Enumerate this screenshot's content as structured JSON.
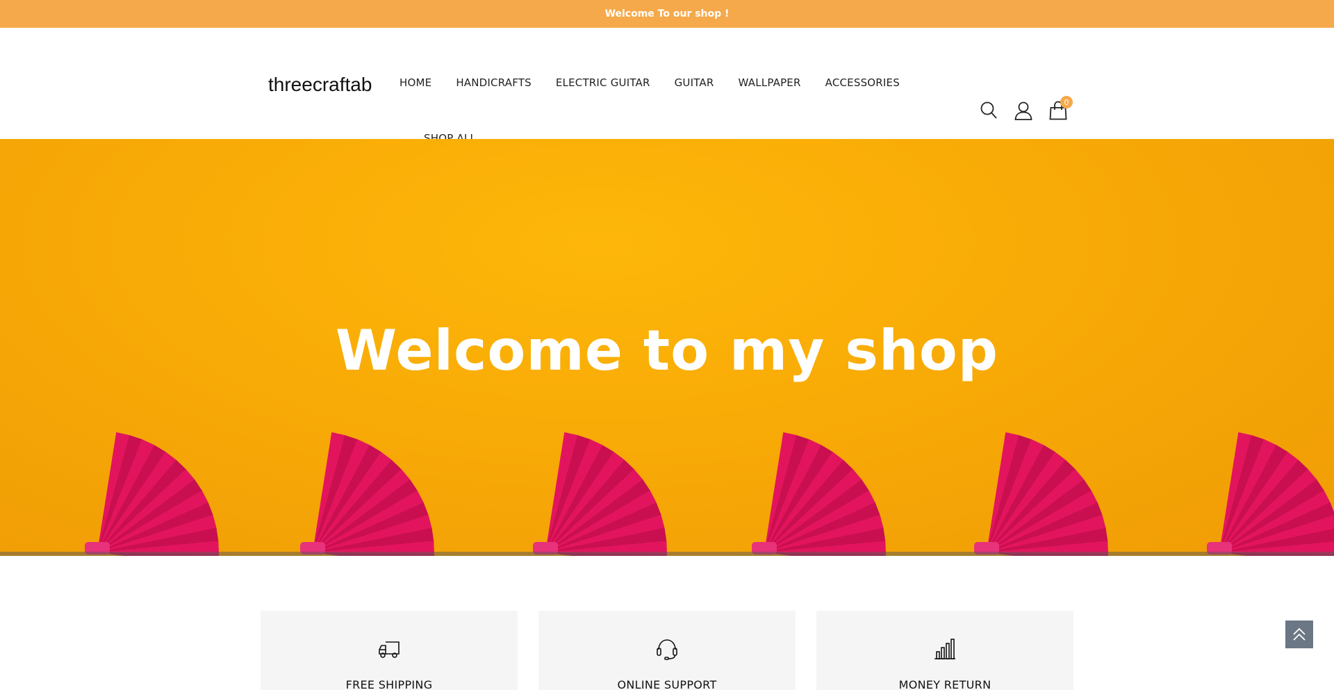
{
  "announcement": {
    "text": "Welcome To our shop !"
  },
  "header": {
    "logo": "threecraftab",
    "nav": [
      {
        "label": "HOME"
      },
      {
        "label": "HANDICRAFTS"
      },
      {
        "label": "ELECTRIC GUITAR"
      },
      {
        "label": "GUITAR"
      },
      {
        "label": "WALLPAPER"
      },
      {
        "label": "ACCESSORIES"
      },
      {
        "label": "SHOP ALL"
      }
    ],
    "icons": [
      "search-icon",
      "user-icon",
      "cart-icon"
    ],
    "cart_count": "0"
  },
  "hero": {
    "title": "Welcome to my shop",
    "background_color": "#f8aa06",
    "accent_color": "#e3145e"
  },
  "features": [
    {
      "icon": "truck-icon",
      "label": "FREE SHIPPING"
    },
    {
      "icon": "headset-icon",
      "label": "ONLINE SUPPORT"
    },
    {
      "icon": "bar-chart-icon",
      "label": "MONEY RETURN"
    }
  ],
  "colors": {
    "announcement_bg": "#f6a94a",
    "back_to_top_bg": "#6b7785"
  }
}
